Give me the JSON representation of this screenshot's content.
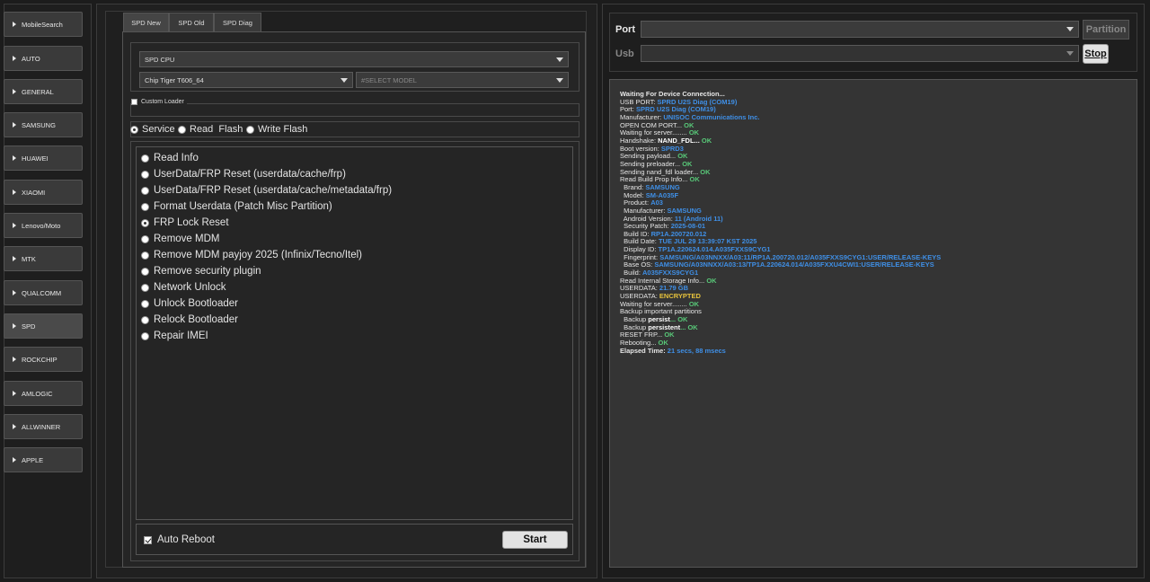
{
  "sidebar": {
    "items": [
      {
        "label": "MobileSearch"
      },
      {
        "label": "AUTO"
      },
      {
        "label": "GENERAL"
      },
      {
        "label": "SAMSUNG"
      },
      {
        "label": "HUAWEI"
      },
      {
        "label": "XIAOMI"
      },
      {
        "label": "Lenovo/Moto"
      },
      {
        "label": "MTK"
      },
      {
        "label": "QUALCOMM"
      },
      {
        "label": "SPD"
      },
      {
        "label": "ROCKCHIP"
      },
      {
        "label": "AMLOGIC"
      },
      {
        "label": "ALLWINNER"
      },
      {
        "label": "APPLE"
      }
    ],
    "active": "SPD"
  },
  "tabs": [
    {
      "label": "SPD New"
    },
    {
      "label": "SPD Old"
    },
    {
      "label": "SPD Diag"
    }
  ],
  "config": {
    "cpu_select": "SPD CPU",
    "chip_select": "Chip Tiger T606_64",
    "model_placeholder": "#SELECT MODEL",
    "custom_loader_label": "Custom Loader"
  },
  "modes": [
    {
      "label": "Service",
      "selected": true
    },
    {
      "label": "Read  Flash",
      "selected": false
    },
    {
      "label": "Write Flash",
      "selected": false
    }
  ],
  "operations": [
    {
      "label": "Read Info",
      "selected": false
    },
    {
      "label": "UserData/FRP Reset (userdata/cache/frp)",
      "selected": false
    },
    {
      "label": "UserData/FRP Reset (userdata/cache/metadata/frp)",
      "selected": false
    },
    {
      "label": "Format Userdata (Patch Misc Partition)",
      "selected": false
    },
    {
      "label": "FRP Lock Reset",
      "selected": true
    },
    {
      "label": "Remove MDM",
      "selected": false
    },
    {
      "label": "Remove MDM payjoy 2025 (Infinix/Tecno/Itel)",
      "selected": false
    },
    {
      "label": "Remove security plugin",
      "selected": false
    },
    {
      "label": "Network Unlock",
      "selected": false
    },
    {
      "label": "Unlock Bootloader",
      "selected": false
    },
    {
      "label": "Relock Bootloader",
      "selected": false
    },
    {
      "label": "Repair IMEI",
      "selected": false
    }
  ],
  "footer": {
    "auto_reboot_label": "Auto Reboot",
    "auto_reboot_checked": true,
    "start_label": "Start"
  },
  "connection": {
    "port_label": "Port",
    "usb_label": "Usb",
    "partition_label": "Partition",
    "stop_label": "Stop"
  },
  "colors": {
    "value_blue": "#3f8fe6",
    "ok_green": "#58c878",
    "warn_yellow": "#e6c23c",
    "white": "#ffffff"
  },
  "log": [
    {
      "text": "Waiting For Device Connection...",
      "bold": true
    },
    {
      "text": "USB PORT: ",
      "value": "SPRD U2S Diag (COM19)",
      "color": "blue"
    },
    {
      "text": "Port: ",
      "value": "SPRD U2S Diag (COM19)",
      "color": "blue"
    },
    {
      "text": "Manufacturer: ",
      "value": "UNISOC Communications Inc.",
      "color": "blue"
    },
    {
      "text": "OPEN COM PORT... ",
      "value": "OK",
      "color": "green"
    },
    {
      "text": "Waiting for server........ ",
      "value": "OK",
      "color": "green"
    },
    {
      "text": "Handshake: ",
      "value": "NAND_FDL...",
      "color": "white",
      "value2": " OK",
      "color2": "green"
    },
    {
      "text": "Boot version: ",
      "value": "SPRD3",
      "color": "blue"
    },
    {
      "text": "Sending payload... ",
      "value": "OK",
      "color": "green"
    },
    {
      "text": "Sending preloader... ",
      "value": "OK",
      "color": "green"
    },
    {
      "text": "Sending nand_fdl loader... ",
      "value": "OK",
      "color": "green"
    },
    {
      "text": "Read Build Prop Info... ",
      "value": "OK",
      "color": "green"
    },
    {
      "text": "  Brand: ",
      "value": "SAMSUNG",
      "color": "blue"
    },
    {
      "text": "  Model: ",
      "value": "SM-A035F",
      "color": "blue"
    },
    {
      "text": "  Product: ",
      "value": "A03",
      "color": "blue"
    },
    {
      "text": "  Manufacturer: ",
      "value": "SAMSUNG",
      "color": "blue"
    },
    {
      "text": "  Android Version: ",
      "value": "11 (Android 11)",
      "color": "blue"
    },
    {
      "text": "  Security Patch: ",
      "value": "2025-08-01",
      "color": "blue"
    },
    {
      "text": "  Build ID: ",
      "value": "RP1A.200720.012",
      "color": "blue"
    },
    {
      "text": "  Build Date: ",
      "value": "TUE JUL 29 13:39:07 KST 2025",
      "color": "blue"
    },
    {
      "text": "  Display ID: ",
      "value": "TP1A.220624.014.A035FXXS9CYG1",
      "color": "blue"
    },
    {
      "text": "  Fingerprint: ",
      "value": "SAMSUNG/A03NNXX/A03:11/RP1A.200720.012/A035FXXS9CYG1:USER/RELEASE-KEYS",
      "color": "blue"
    },
    {
      "text": "  Base OS: ",
      "value": "SAMSUNG/A03NNXX/A03:13/TP1A.220624.014/A035FXXU4CWI1:USER/RELEASE-KEYS",
      "color": "blue"
    },
    {
      "text": "  Build: ",
      "value": "A035FXXS9CYG1",
      "color": "blue"
    },
    {
      "text": "Read Internal Storage Info... ",
      "value": "OK",
      "color": "green"
    },
    {
      "text": "USERDATA: ",
      "value": "21.79 GB",
      "color": "blue"
    },
    {
      "text": "USERDATA: ",
      "value": "ENCRYPTED",
      "color": "yellow"
    },
    {
      "text": "Waiting for server........ ",
      "value": "OK",
      "color": "green"
    },
    {
      "text": "Backup important partitions"
    },
    {
      "text": "  Backup ",
      "value": "persist",
      "color": "white",
      "value2": "... OK",
      "color2": "green"
    },
    {
      "text": "  Backup ",
      "value": "persistent",
      "color": "white",
      "value2": "... OK",
      "color2": "green"
    },
    {
      "text": "RESET FRP... ",
      "value": "OK",
      "color": "green"
    },
    {
      "text": "Rebooting... ",
      "value": "OK",
      "color": "green"
    },
    {
      "text": "Elapsed Time: ",
      "bold": true,
      "value": "21 secs, 88 msecs",
      "color": "blue"
    }
  ]
}
